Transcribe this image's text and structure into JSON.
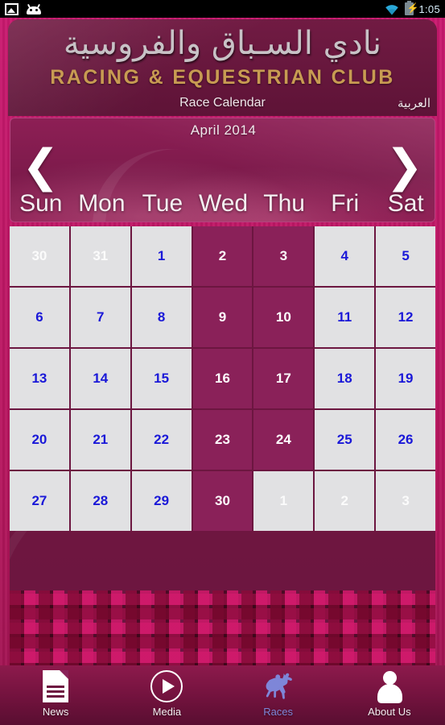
{
  "statusbar": {
    "time": "1:05",
    "icons": [
      "image-icon",
      "android-icon",
      "wifi-icon",
      "battery-charging-icon"
    ]
  },
  "header": {
    "title_arabic": "نادي السـباق والفروسية",
    "title_english": "RACING & EQUESTRIAN CLUB",
    "page_title": "Race Calendar",
    "language_link": "العربية"
  },
  "calendar": {
    "month_year": "April  2014",
    "prev_arrow": "❮",
    "next_arrow": "❯",
    "daynames": [
      "Sun",
      "Mon",
      "Tue",
      "Wed",
      "Thu",
      "Fri",
      "Sat"
    ],
    "weeks": [
      [
        {
          "day": "30",
          "state": "muted"
        },
        {
          "day": "31",
          "state": "muted"
        },
        {
          "day": "1",
          "state": "normal"
        },
        {
          "day": "2",
          "state": "race"
        },
        {
          "day": "3",
          "state": "race"
        },
        {
          "day": "4",
          "state": "normal"
        },
        {
          "day": "5",
          "state": "normal"
        }
      ],
      [
        {
          "day": "6",
          "state": "normal"
        },
        {
          "day": "7",
          "state": "normal"
        },
        {
          "day": "8",
          "state": "normal"
        },
        {
          "day": "9",
          "state": "race"
        },
        {
          "day": "10",
          "state": "race"
        },
        {
          "day": "11",
          "state": "normal"
        },
        {
          "day": "12",
          "state": "normal"
        }
      ],
      [
        {
          "day": "13",
          "state": "normal"
        },
        {
          "day": "14",
          "state": "normal"
        },
        {
          "day": "15",
          "state": "normal"
        },
        {
          "day": "16",
          "state": "race"
        },
        {
          "day": "17",
          "state": "race"
        },
        {
          "day": "18",
          "state": "normal"
        },
        {
          "day": "19",
          "state": "normal"
        }
      ],
      [
        {
          "day": "20",
          "state": "normal"
        },
        {
          "day": "21",
          "state": "normal"
        },
        {
          "day": "22",
          "state": "normal"
        },
        {
          "day": "23",
          "state": "race"
        },
        {
          "day": "24",
          "state": "race"
        },
        {
          "day": "25",
          "state": "normal"
        },
        {
          "day": "26",
          "state": "normal"
        }
      ],
      [
        {
          "day": "27",
          "state": "normal"
        },
        {
          "day": "28",
          "state": "normal"
        },
        {
          "day": "29",
          "state": "normal"
        },
        {
          "day": "30",
          "state": "race"
        },
        {
          "day": "1",
          "state": "muted"
        },
        {
          "day": "2",
          "state": "muted"
        },
        {
          "day": "3",
          "state": "muted"
        }
      ]
    ]
  },
  "bottomnav": {
    "items": [
      {
        "label": "News",
        "icon": "news-document-icon",
        "active": false
      },
      {
        "label": "Media",
        "icon": "media-play-icon",
        "active": false
      },
      {
        "label": "Races",
        "icon": "horse-racing-icon",
        "active": true
      },
      {
        "label": "About Us",
        "icon": "person-icon",
        "active": false
      }
    ]
  },
  "colors": {
    "frame_pink": "#c0176a",
    "header_maroon": "#6b1540",
    "gold": "#c89b52",
    "race_cell": "#8a2159",
    "cell_bg": "#e1e1e3",
    "cell_text_blue": "#1a18d8",
    "active_tab_blue": "#7e86d8"
  }
}
